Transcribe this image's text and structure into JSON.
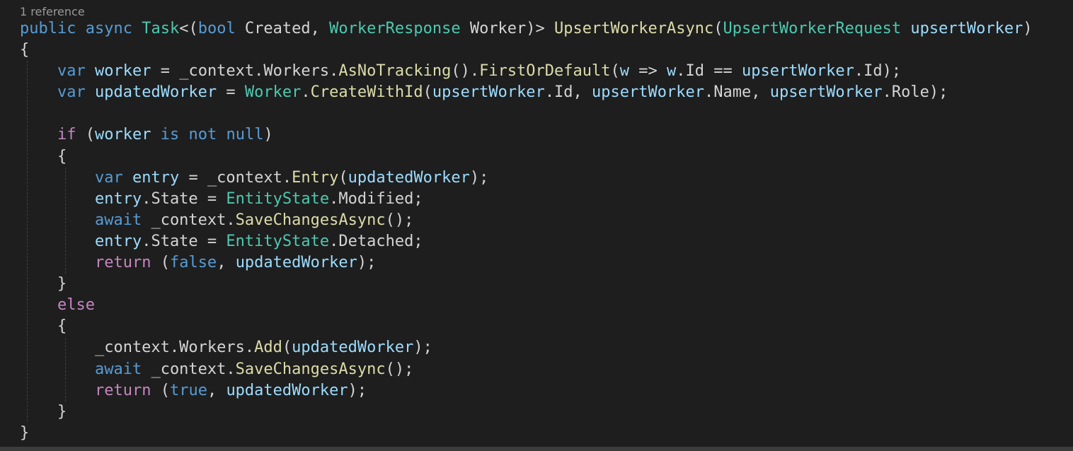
{
  "codelens": {
    "references": "1 reference"
  },
  "code": {
    "lines": [
      [
        {
          "t": "public",
          "c": "kw"
        },
        {
          "t": " ",
          "c": "pl"
        },
        {
          "t": "async",
          "c": "kw"
        },
        {
          "t": " ",
          "c": "pl"
        },
        {
          "t": "Task",
          "c": "ty"
        },
        {
          "t": "<(",
          "c": "pl"
        },
        {
          "t": "bool",
          "c": "kw"
        },
        {
          "t": " Created, ",
          "c": "pl"
        },
        {
          "t": "WorkerResponse",
          "c": "ty"
        },
        {
          "t": " Worker)> ",
          "c": "pl"
        },
        {
          "t": "UpsertWorkerAsync",
          "c": "fn"
        },
        {
          "t": "(",
          "c": "pl"
        },
        {
          "t": "UpsertWorkerRequest",
          "c": "ty"
        },
        {
          "t": " ",
          "c": "pl"
        },
        {
          "t": "upsertWorker",
          "c": "var"
        },
        {
          "t": ")",
          "c": "pl"
        }
      ],
      [
        {
          "t": "{",
          "c": "pl"
        }
      ],
      [
        {
          "t": "    ",
          "c": "pl"
        },
        {
          "t": "var",
          "c": "kw"
        },
        {
          "t": " ",
          "c": "pl"
        },
        {
          "t": "worker",
          "c": "var"
        },
        {
          "t": " = _context.Workers.",
          "c": "pl"
        },
        {
          "t": "AsNoTracking",
          "c": "fn"
        },
        {
          "t": "().",
          "c": "pl"
        },
        {
          "t": "FirstOrDefault",
          "c": "fn"
        },
        {
          "t": "(",
          "c": "pl"
        },
        {
          "t": "w",
          "c": "var"
        },
        {
          "t": " => ",
          "c": "pl"
        },
        {
          "t": "w",
          "c": "var"
        },
        {
          "t": ".Id == ",
          "c": "pl"
        },
        {
          "t": "upsertWorker",
          "c": "var"
        },
        {
          "t": ".Id);",
          "c": "pl"
        }
      ],
      [
        {
          "t": "    ",
          "c": "pl"
        },
        {
          "t": "var",
          "c": "kw"
        },
        {
          "t": " ",
          "c": "pl"
        },
        {
          "t": "updatedWorker",
          "c": "var"
        },
        {
          "t": " = ",
          "c": "pl"
        },
        {
          "t": "Worker",
          "c": "ty"
        },
        {
          "t": ".",
          "c": "pl"
        },
        {
          "t": "CreateWithId",
          "c": "fn"
        },
        {
          "t": "(",
          "c": "pl"
        },
        {
          "t": "upsertWorker",
          "c": "var"
        },
        {
          "t": ".Id, ",
          "c": "pl"
        },
        {
          "t": "upsertWorker",
          "c": "var"
        },
        {
          "t": ".Name, ",
          "c": "pl"
        },
        {
          "t": "upsertWorker",
          "c": "var"
        },
        {
          "t": ".Role);",
          "c": "pl"
        }
      ],
      [],
      [
        {
          "t": "    ",
          "c": "pl"
        },
        {
          "t": "if",
          "c": "ctl"
        },
        {
          "t": " (",
          "c": "pl"
        },
        {
          "t": "worker",
          "c": "var"
        },
        {
          "t": " ",
          "c": "pl"
        },
        {
          "t": "is",
          "c": "kw"
        },
        {
          "t": " ",
          "c": "pl"
        },
        {
          "t": "not",
          "c": "kw"
        },
        {
          "t": " ",
          "c": "pl"
        },
        {
          "t": "null",
          "c": "kw"
        },
        {
          "t": ")",
          "c": "pl"
        }
      ],
      [
        {
          "t": "    {",
          "c": "pl"
        }
      ],
      [
        {
          "t": "        ",
          "c": "pl"
        },
        {
          "t": "var",
          "c": "kw"
        },
        {
          "t": " ",
          "c": "pl"
        },
        {
          "t": "entry",
          "c": "var"
        },
        {
          "t": " = _context.",
          "c": "pl"
        },
        {
          "t": "Entry",
          "c": "fn"
        },
        {
          "t": "(",
          "c": "pl"
        },
        {
          "t": "updatedWorker",
          "c": "var"
        },
        {
          "t": ");",
          "c": "pl"
        }
      ],
      [
        {
          "t": "        ",
          "c": "pl"
        },
        {
          "t": "entry",
          "c": "var"
        },
        {
          "t": ".State = ",
          "c": "pl"
        },
        {
          "t": "EntityState",
          "c": "ty"
        },
        {
          "t": ".Modified;",
          "c": "pl"
        }
      ],
      [
        {
          "t": "        ",
          "c": "pl"
        },
        {
          "t": "await",
          "c": "kw"
        },
        {
          "t": " _context.",
          "c": "pl"
        },
        {
          "t": "SaveChangesAsync",
          "c": "fn"
        },
        {
          "t": "();",
          "c": "pl"
        }
      ],
      [
        {
          "t": "        ",
          "c": "pl"
        },
        {
          "t": "entry",
          "c": "var"
        },
        {
          "t": ".State = ",
          "c": "pl"
        },
        {
          "t": "EntityState",
          "c": "ty"
        },
        {
          "t": ".Detached;",
          "c": "pl"
        }
      ],
      [
        {
          "t": "        ",
          "c": "pl"
        },
        {
          "t": "return",
          "c": "ctl"
        },
        {
          "t": " (",
          "c": "pl"
        },
        {
          "t": "false",
          "c": "kw"
        },
        {
          "t": ", ",
          "c": "pl"
        },
        {
          "t": "updatedWorker",
          "c": "var"
        },
        {
          "t": ");",
          "c": "pl"
        }
      ],
      [
        {
          "t": "    }",
          "c": "pl"
        }
      ],
      [
        {
          "t": "    ",
          "c": "pl"
        },
        {
          "t": "else",
          "c": "ctl"
        }
      ],
      [
        {
          "t": "    {",
          "c": "pl"
        }
      ],
      [
        {
          "t": "        _context.Workers.",
          "c": "pl"
        },
        {
          "t": "Add",
          "c": "fn"
        },
        {
          "t": "(",
          "c": "pl"
        },
        {
          "t": "updatedWorker",
          "c": "var"
        },
        {
          "t": ");",
          "c": "pl"
        }
      ],
      [
        {
          "t": "        ",
          "c": "pl"
        },
        {
          "t": "await",
          "c": "kw"
        },
        {
          "t": " _context.",
          "c": "pl"
        },
        {
          "t": "SaveChangesAsync",
          "c": "fn"
        },
        {
          "t": "();",
          "c": "pl"
        }
      ],
      [
        {
          "t": "        ",
          "c": "pl"
        },
        {
          "t": "return",
          "c": "ctl"
        },
        {
          "t": " (",
          "c": "pl"
        },
        {
          "t": "true",
          "c": "kw"
        },
        {
          "t": ", ",
          "c": "pl"
        },
        {
          "t": "updatedWorker",
          "c": "var"
        },
        {
          "t": ");",
          "c": "pl"
        }
      ],
      [
        {
          "t": "    }",
          "c": "pl"
        }
      ],
      [
        {
          "t": "}",
          "c": "pl"
        }
      ]
    ]
  },
  "theme": {
    "background": "#1e1e1e",
    "keyword": "#569cd6",
    "control": "#c586c0",
    "type": "#4ec9b0",
    "function": "#dcdcaa",
    "variable": "#9cdcfe",
    "plain": "#d4d4d4",
    "codelens": "#999999"
  }
}
